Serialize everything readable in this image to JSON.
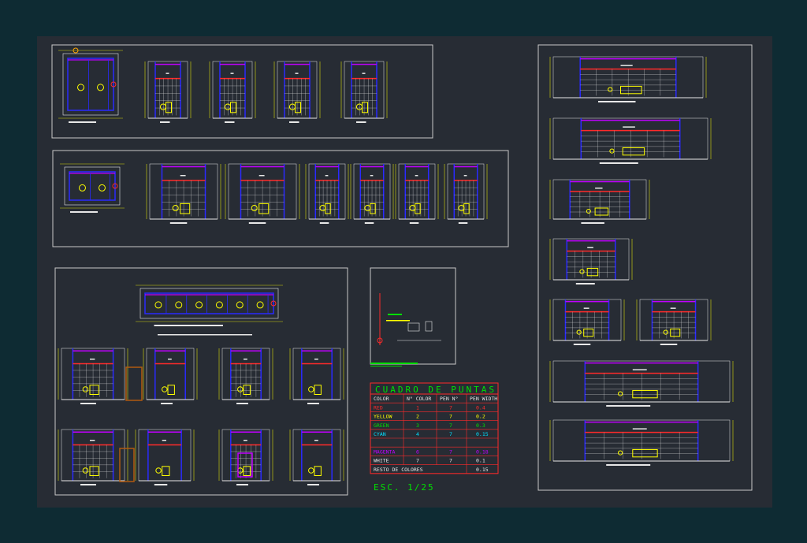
{
  "colors": {
    "background": "#0e2b33",
    "sheet": "#272c34",
    "frame": "#c8c8c8",
    "red": "#ff2a2a",
    "yellow": "#ffff00",
    "green": "#00e000",
    "cyan": "#00e0ff",
    "magenta": "#c000ff",
    "blue": "#2a2aff",
    "white": "#e8e8e8",
    "brown": "#b05a10"
  },
  "legend_table": {
    "title": "CUADRO DE PUNTAS",
    "headers": [
      "COLOR",
      "N° COLOR",
      "PEN N°",
      "PEN WIDTH"
    ],
    "rows": [
      {
        "color": "RED",
        "num": "1",
        "pen": "7",
        "width": "0.4",
        "hex": "#ff2a2a"
      },
      {
        "color": "YELLOW",
        "num": "2",
        "pen": "7",
        "width": "0.2",
        "hex": "#ffff00"
      },
      {
        "color": "GREEN",
        "num": "3",
        "pen": "7",
        "width": "0.3",
        "hex": "#00e000"
      },
      {
        "color": "CYAN",
        "num": "4",
        "pen": "7",
        "width": "0.15",
        "hex": "#00e0ff"
      },
      {
        "color": "",
        "num": "",
        "pen": "",
        "width": "",
        "hex": "#e8e8e8"
      },
      {
        "color": "MAGENTA",
        "num": "6",
        "pen": "7",
        "width": "0.18",
        "hex": "#c000ff"
      },
      {
        "color": "WHITE",
        "num": "7",
        "pen": "7",
        "width": "0.1",
        "hex": "#e8e8e8"
      }
    ],
    "footer_label": "RESTO DE COLORES",
    "footer_value": "0.15"
  },
  "scale_label": "ESC. 1/25"
}
